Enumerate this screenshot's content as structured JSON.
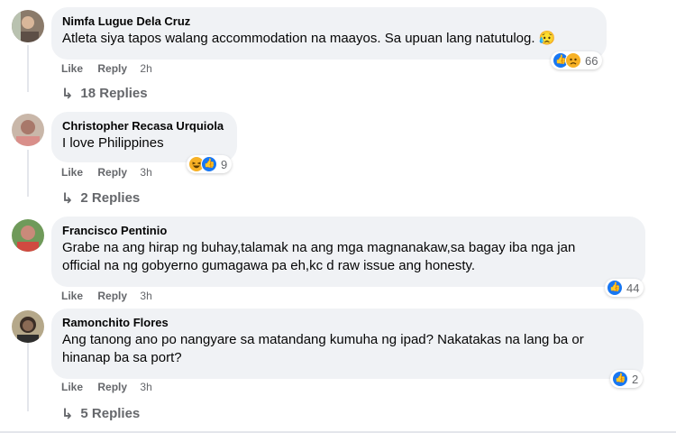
{
  "comments": [
    {
      "author": "Nimfa Lugue Dela Cruz",
      "text": "Atleta siya tapos walang accommodation na maayos. Sa upuan lang natutulog. 😥",
      "like": "Like",
      "reply": "Reply",
      "time": "2h",
      "reaction_count": "66",
      "reactions": [
        "like-icon",
        "sad-icon"
      ],
      "replies": "18 Replies"
    },
    {
      "author": "Christopher Recasa Urquiola",
      "text": "I love Philippines",
      "like": "Like",
      "reply": "Reply",
      "time": "3h",
      "reaction_count": "9",
      "reactions": [
        "haha-icon",
        "like-icon"
      ],
      "replies": "2 Replies"
    },
    {
      "author": "Francisco Pentinio",
      "text_line1": "Grabe na ang hirap ng buhay,talamak na ang mga magnanakaw,sa bagay iba nga jan",
      "text_line2": "official na ng gobyerno gumagawa pa eh,kc d raw issue ang honesty.",
      "like": "Like",
      "reply": "Reply",
      "time": "3h",
      "reaction_count": "44",
      "reactions": [
        "like-icon"
      ]
    },
    {
      "author": "Ramonchito Flores",
      "text_line1": "Ang tanong ano po nangyare sa matandang kumuha ng ipad? Nakatakas na lang ba or",
      "text_line2": "hinanap ba sa port?",
      "like": "Like",
      "reply": "Reply",
      "time": "3h",
      "reaction_count": "2",
      "reactions": [
        "like-icon"
      ],
      "replies": "5 Replies"
    }
  ],
  "colors": {
    "bubble": "#f0f2f5",
    "secondary_text": "#65676b",
    "like_blue": "#1877f2",
    "emoji_yellow": "#f7b125"
  }
}
